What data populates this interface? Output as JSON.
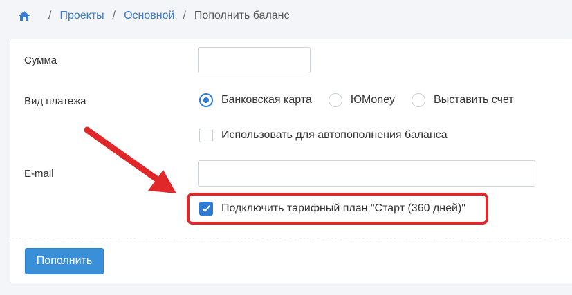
{
  "breadcrumb": {
    "home_icon": "home-icon",
    "items": [
      "Проекты",
      "Основной"
    ],
    "current": "Пополнить баланс",
    "separator": "/"
  },
  "form": {
    "amount_label": "Сумма",
    "amount_value": "",
    "payment_label": "Вид платежа",
    "payment_options": [
      "Банковская карта",
      "ЮMoney",
      "Выставить счет"
    ],
    "payment_selected": "Банковская карта",
    "autopay_label": "Использовать для автопополнения баланса",
    "autopay_checked": false,
    "email_label": "E-mail",
    "email_value": "",
    "tariff_label": "Подключить тарифный план \"Старт (360 дней)\"",
    "tariff_checked": true,
    "submit_label": "Пополнить"
  },
  "colors": {
    "accent": "#2e7bd6",
    "button": "#3a8fd9",
    "highlight": "#e0272a",
    "link": "#3a7bd5"
  }
}
